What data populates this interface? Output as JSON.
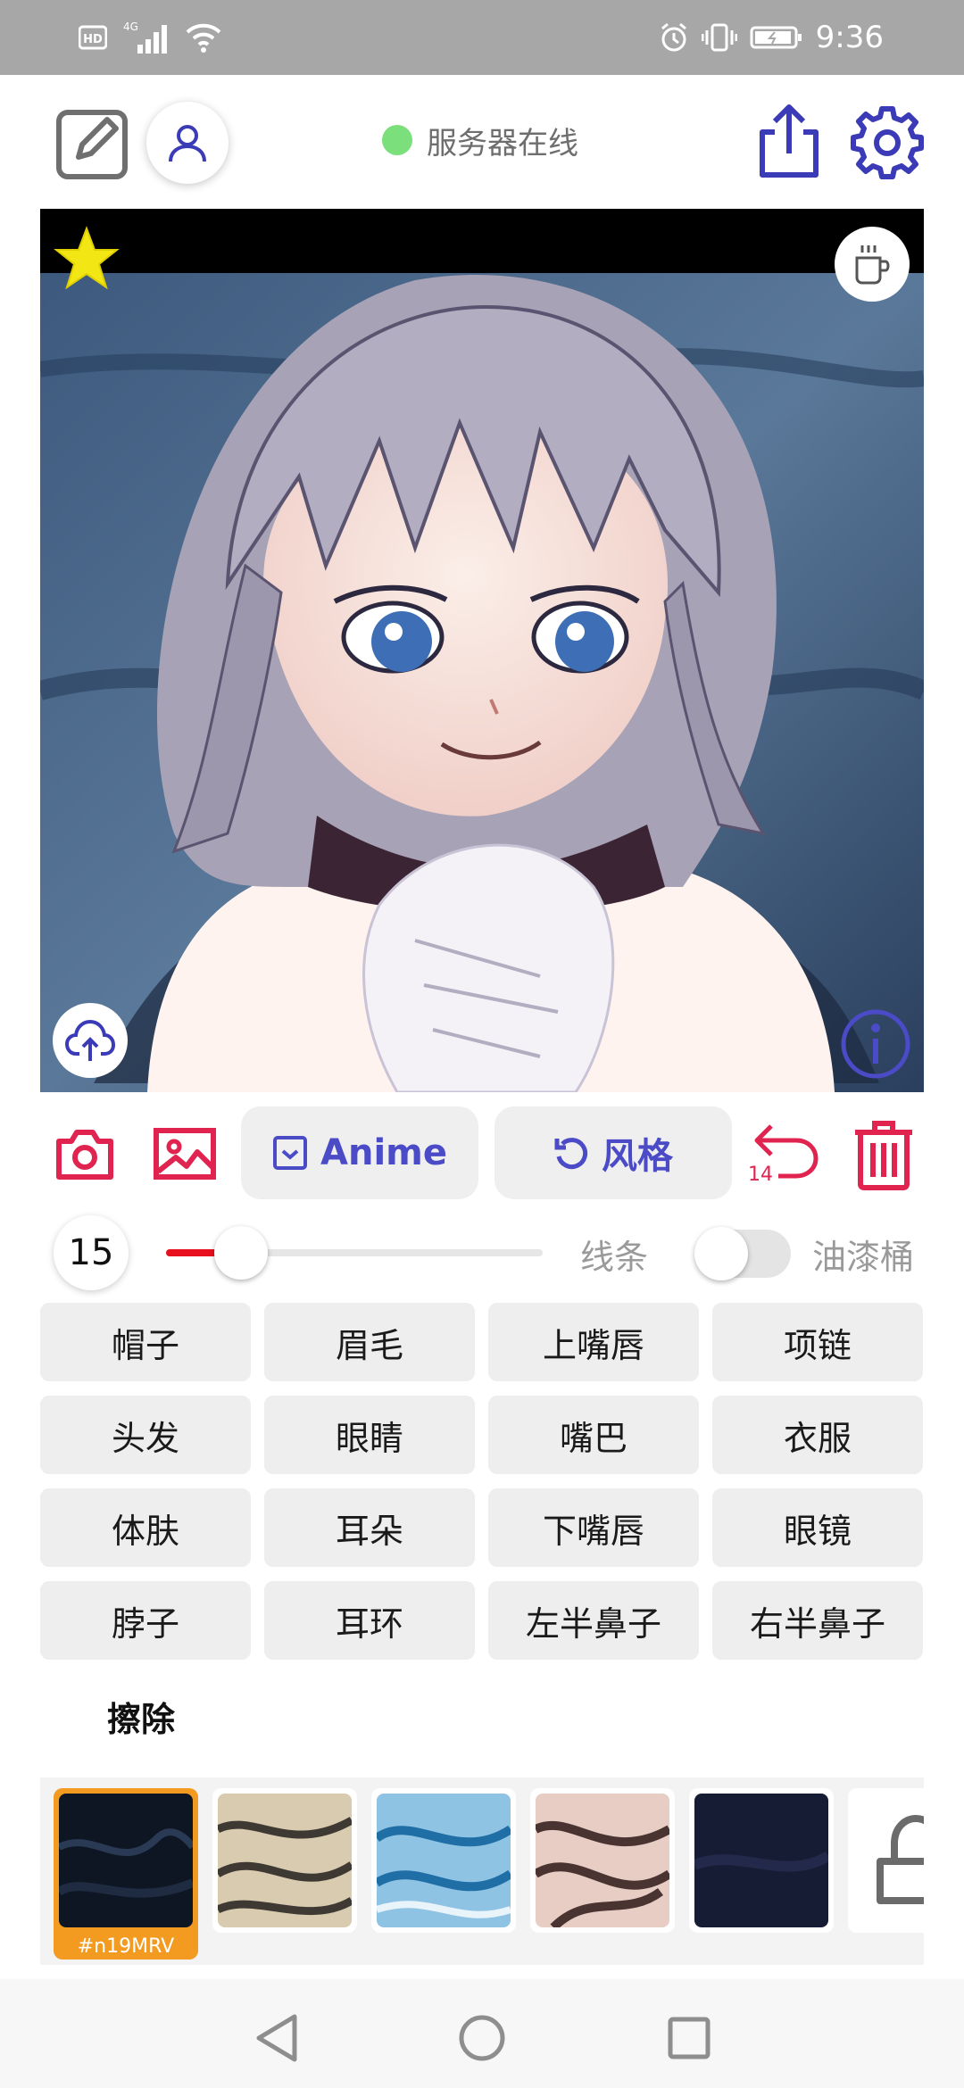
{
  "status_bar": {
    "time": "9:36",
    "icons": [
      "hd-icon",
      "signal-4g-icon",
      "wifi-icon",
      "alarm-icon",
      "vibrate-icon",
      "battery-icon"
    ]
  },
  "toolbar": {
    "server_status": "服务器在线",
    "server_status_color": "#7be07b",
    "icons": [
      "edit-icon",
      "user-icon",
      "share-icon",
      "settings-icon"
    ],
    "accent_color": "#3b3bb8"
  },
  "canvas": {
    "icons": [
      "star-icon",
      "coffee-icon",
      "upload-cloud-icon",
      "info-icon"
    ]
  },
  "actions": {
    "anime_label": "Anime",
    "style_label": "风格",
    "undo_count": "14",
    "icons": [
      "camera-icon",
      "image-icon",
      "checkbox-icon",
      "refresh-icon",
      "undo-icon",
      "trash-icon"
    ],
    "danger_color": "#e0244f"
  },
  "brush": {
    "size": "15",
    "slider_fraction": 0.2,
    "line_label": "线条",
    "bucket_label": "油漆桶",
    "bucket_enabled": false
  },
  "parts": [
    "帽子",
    "眉毛",
    "上嘴唇",
    "项链",
    "头发",
    "眼睛",
    "嘴巴",
    "衣服",
    "体肤",
    "耳朵",
    "下嘴唇",
    "眼镜",
    "脖子",
    "耳环",
    "左半鼻子",
    "右半鼻子"
  ],
  "erase_label": "擦除",
  "styles": {
    "selected_label": "#n19MRV",
    "items": [
      "style-dark-blue",
      "style-beige-marble",
      "style-light-blue",
      "style-pink-marble",
      "style-navy",
      "style-locked"
    ]
  },
  "nav": {
    "icons": [
      "back-icon",
      "home-icon",
      "recents-icon"
    ]
  }
}
